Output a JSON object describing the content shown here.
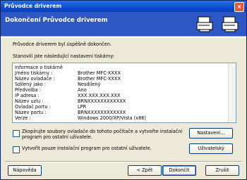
{
  "window": {
    "title": "Průvodce driverem",
    "close_symbol": "×"
  },
  "banner": {
    "title": "Dokončení Průvodce driverem"
  },
  "main": {
    "success_text": "Průvodce driverem byl úspěšně dokončen.",
    "settings_intro": "Stanovili jste následující nastavení tiskárny:"
  },
  "printer_info": {
    "heading": "Informace o tiskárně",
    "rows": [
      {
        "label": "Jméno tiskárny :",
        "value": "Brother MFC-XXXX"
      },
      {
        "label": "Název ovladače :",
        "value": "Brother MFC-XXXX"
      },
      {
        "label": "Sdílený jako :",
        "value": "Nesdílený"
      },
      {
        "label": "Předvolba :",
        "value": "Ano"
      },
      {
        "label": "IP adresa :",
        "value": "XXX.XXX.XXX.XXX"
      },
      {
        "label": "Název uzlu :",
        "value": "BRNXXXXXXXXXXXX"
      },
      {
        "label": "Ovladač portu :",
        "value": "LPR"
      },
      {
        "label": "Název portu :",
        "value": "BRNXXXXXXXXXXXX"
      },
      {
        "label": "Verze :",
        "value": "Windows 2000/XP/Vista (x86)"
      }
    ]
  },
  "options": {
    "copy_files_line1": "Zkopírujte soubory ovladače do tohoto počítače a vytvořte instalační",
    "copy_files_line2": "program pro ostatní uživatele.",
    "installer_only": "Vytvořit pouze instalační program pro ostatní uživatele."
  },
  "buttons": {
    "settings": "Nastavení...",
    "user": "Uživatelský",
    "help": "Nápověda",
    "back": "< Zpět",
    "finish": "Dokončit",
    "cancel": "Zrušit"
  }
}
